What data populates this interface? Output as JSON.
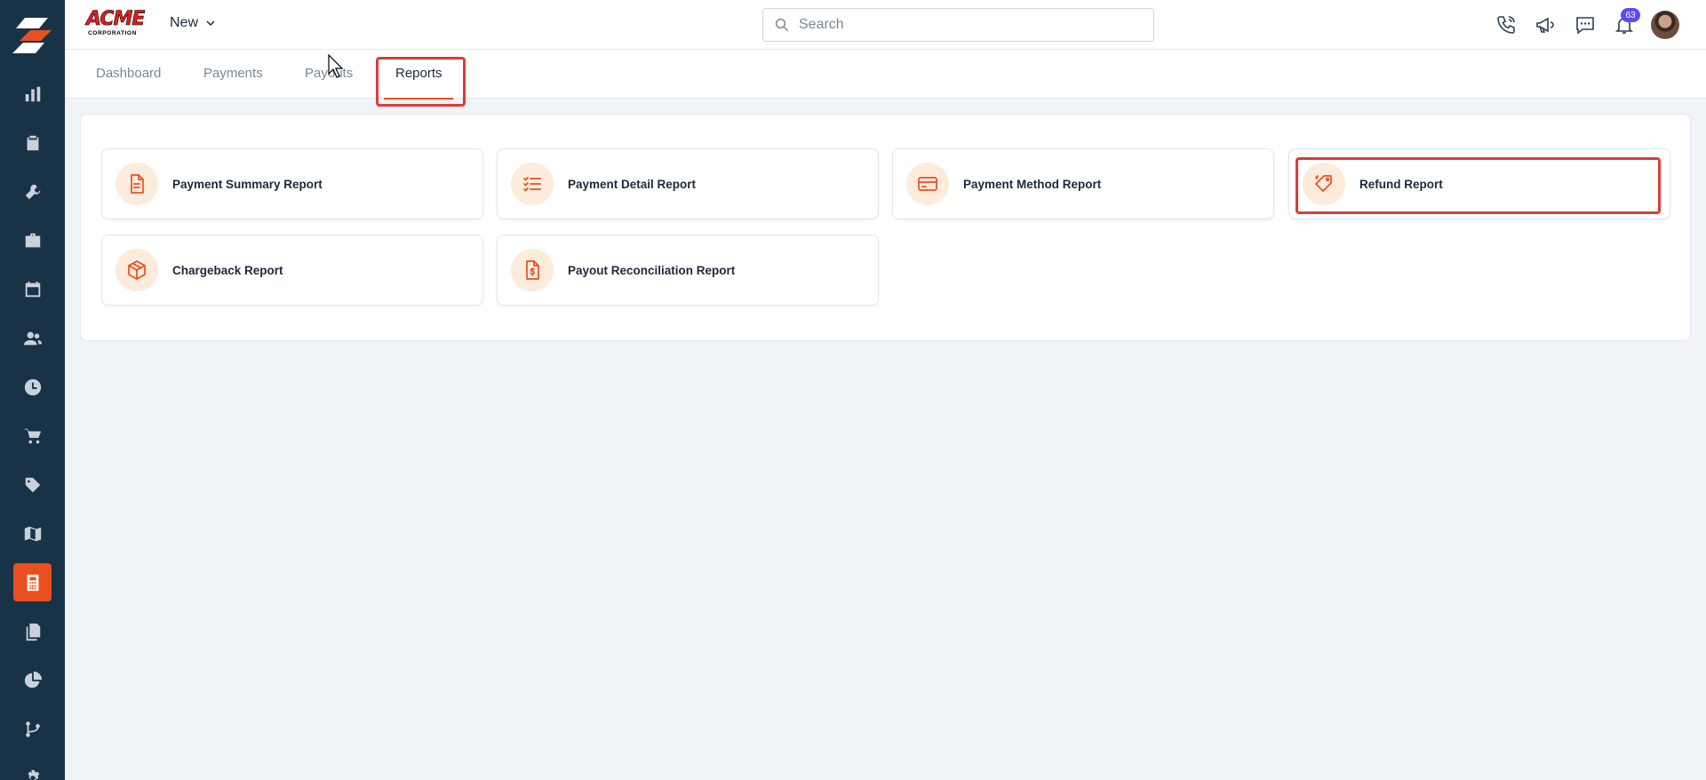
{
  "brand": {
    "name": "ACME",
    "subtitle": "CORPORATION"
  },
  "header": {
    "new_label": "New",
    "search_placeholder": "Search",
    "notification_count": "63"
  },
  "tabs": [
    {
      "label": "Dashboard"
    },
    {
      "label": "Payments"
    },
    {
      "label": "Payouts"
    },
    {
      "label": "Reports"
    }
  ],
  "active_tab": "Reports",
  "reports": [
    {
      "label": "Payment Summary Report",
      "icon": "document-icon"
    },
    {
      "label": "Payment Detail Report",
      "icon": "checklist-icon"
    },
    {
      "label": "Payment Method Report",
      "icon": "credit-card-icon"
    },
    {
      "label": "Refund Report",
      "icon": "tag-icon"
    },
    {
      "label": "Chargeback Report",
      "icon": "box-icon"
    },
    {
      "label": "Payout Reconciliation Report",
      "icon": "invoice-dollar-icon"
    }
  ],
  "sidebar": {
    "items": [
      {
        "icon": "bar-chart-icon"
      },
      {
        "icon": "clipboard-check-icon"
      },
      {
        "icon": "tools-icon"
      },
      {
        "icon": "briefcase-icon"
      },
      {
        "icon": "calendar-icon"
      },
      {
        "icon": "users-icon"
      },
      {
        "icon": "clock-icon"
      },
      {
        "icon": "cart-icon"
      },
      {
        "icon": "tag-icon"
      },
      {
        "icon": "map-icon"
      },
      {
        "icon": "calculator-icon"
      },
      {
        "icon": "files-icon"
      },
      {
        "icon": "pie-chart-icon"
      },
      {
        "icon": "branch-icon"
      },
      {
        "icon": "settings-icon"
      }
    ],
    "active": "calculator-icon"
  },
  "colors": {
    "sidebar_bg": "#183247",
    "accent": "#e8501f",
    "highlight": "#e03a3a",
    "badge": "#5b4cf0"
  }
}
